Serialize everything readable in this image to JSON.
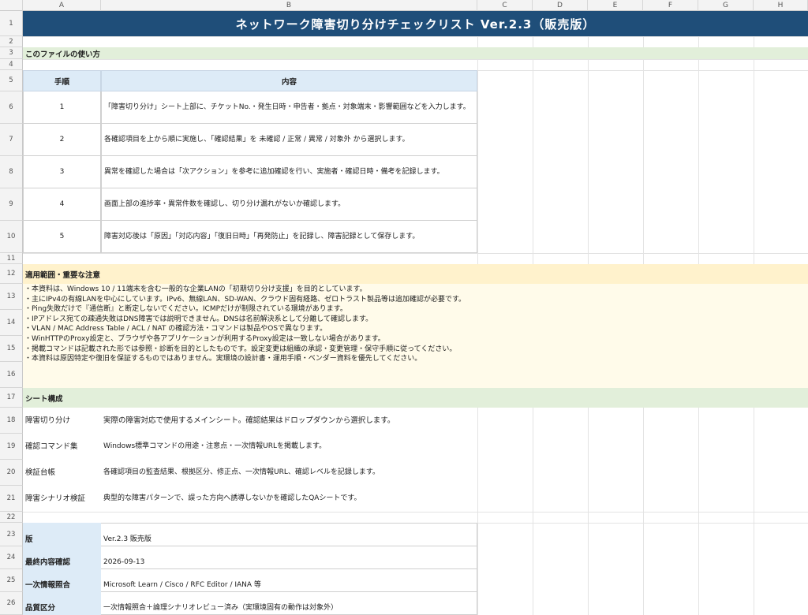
{
  "columns": [
    "A",
    "B",
    "C",
    "D",
    "E",
    "F",
    "G",
    "H"
  ],
  "rows": [
    "1",
    "2",
    "3",
    "4",
    "5",
    "6",
    "7",
    "8",
    "9",
    "10",
    "11",
    "12",
    "13",
    "14",
    "15",
    "16",
    "17",
    "18",
    "19",
    "20",
    "21",
    "22",
    "23",
    "24",
    "25",
    "26"
  ],
  "title": "ネットワーク障害切り分けチェックリスト Ver.2.3（販売版）",
  "usage_heading": "このファイルの使い方",
  "steps_table": {
    "header_step": "手順",
    "header_content": "内容",
    "rows": [
      {
        "step": "1",
        "text": "「障害切り分け」シート上部に、チケットNo.・発生日時・申告者・拠点・対象端末・影響範囲などを入力します。"
      },
      {
        "step": "2",
        "text": "各確認項目を上から順に実施し、「確認結果」を 未確認 / 正常 / 異常 / 対象外 から選択します。"
      },
      {
        "step": "3",
        "text": "異常を確認した場合は「次アクション」を参考に追加確認を行い、実施者・確認日時・備考を記録します。"
      },
      {
        "step": "4",
        "text": "画面上部の進捗率・異常件数を確認し、切り分け漏れがないか確認します。"
      },
      {
        "step": "5",
        "text": "障害対応後は「原因」「対応内容」「復旧日時」「再発防止」を記録し、障害記録として保存します。"
      }
    ]
  },
  "scope_heading": "適用範囲・重要な注意",
  "notes": [
    "・本資料は、Windows 10 / 11端末を含む一般的な企業LANの「初期切り分け支援」を目的としています。",
    "・主にIPv4の有線LANを中心にしています。IPv6、無線LAN、SD-WAN、クラウド固有経路、ゼロトラスト製品等は追加確認が必要です。",
    "・Ping失敗だけで『通信断』と断定しないでください。ICMPだけが制限されている環境があります。",
    "・IPアドレス宛ての疎通失敗はDNS障害では説明できません。DNSは名前解決系として分離して確認します。",
    "・VLAN / MAC Address Table / ACL / NAT の確認方法・コマンドは製品やOSで異なります。",
    "・WinHTTPのProxy設定と、ブラウザや各アプリケーションが利用するProxy設定は一致しない場合があります。",
    "・掲載コマンドは記載された形では参照・診断を目的としたものです。設定変更は組織の承認・変更管理・保守手順に従ってください。",
    "・本資料は原因特定や復旧を保証するものではありません。実環境の設計書・運用手順・ベンダー資料を優先してください。"
  ],
  "sheets_heading": "シート構成",
  "sheets": [
    {
      "name": "障害切り分け",
      "desc": "実際の障害対応で使用するメインシート。確認結果はドロップダウンから選択します。"
    },
    {
      "name": "確認コマンド集",
      "desc": "Windows標準コマンドの用途・注意点・一次情報URLを掲載します。"
    },
    {
      "name": "検証台帳",
      "desc": "各確認項目の監査結果、根拠区分、修正点、一次情報URL、確認レベルを記録します。"
    },
    {
      "name": "障害シナリオ検証",
      "desc": "典型的な障害パターンで、誤った方向へ誘導しないかを確認したQAシートです。"
    }
  ],
  "meta": [
    {
      "key": "版",
      "value": "Ver.2.3 販売版"
    },
    {
      "key": "最終内容確認",
      "value": "2026-09-13"
    },
    {
      "key": "一次情報照合",
      "value": "Microsoft Learn / Cisco / RFC Editor / IANA 等"
    },
    {
      "key": "品質区分",
      "value": "一次情報照合＋論理シナリオレビュー済み（実環境固有の動作は対象外）"
    }
  ],
  "colors": {
    "title_bg": "#1f4e79",
    "header_bg": "#ddebf7",
    "band_green": "#e2efda",
    "band_yellow": "#fff2cc",
    "note_bg": "#fffbea"
  }
}
